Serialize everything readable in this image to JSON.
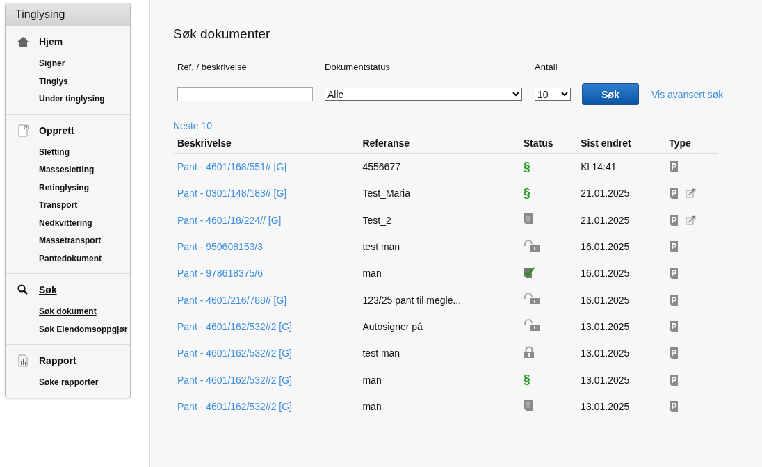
{
  "sidebar": {
    "title": "Tinglysing",
    "sections": [
      {
        "kind": "home",
        "label": "Hjem",
        "selected": false,
        "items": [
          {
            "label": "Signer",
            "selected": false
          },
          {
            "label": "Tinglys",
            "selected": false
          },
          {
            "label": "Under tinglysing",
            "selected": false
          }
        ]
      },
      {
        "kind": "create",
        "label": "Opprett",
        "selected": false,
        "items": [
          {
            "label": "Sletting",
            "selected": false
          },
          {
            "label": "Massesletting",
            "selected": false
          },
          {
            "label": "Retinglysing",
            "selected": false
          },
          {
            "label": "Transport",
            "selected": false
          },
          {
            "label": "Nedkvittering",
            "selected": false
          },
          {
            "label": "Massetransport",
            "selected": false
          },
          {
            "label": "Pantedokument",
            "selected": false
          }
        ]
      },
      {
        "kind": "search",
        "label": "Søk",
        "selected": true,
        "items": [
          {
            "label": "Søk dokument",
            "selected": true
          },
          {
            "label": "Søk Eiendomsoppgjør",
            "selected": false
          }
        ]
      },
      {
        "kind": "report",
        "label": "Rapport",
        "selected": false,
        "items": [
          {
            "label": "Søke rapporter",
            "selected": false
          }
        ]
      }
    ]
  },
  "main": {
    "title": "Søk dokumenter",
    "filters": {
      "ref_label": "Ref. / beskrivelse",
      "status_label": "Dokumentstatus",
      "status_value": "Alle",
      "count_label": "Antall",
      "count_value": "10",
      "search_button": "Søk",
      "advanced_link": "Vis avansert søk"
    },
    "next_link": "Neste 10",
    "table": {
      "columns": [
        "Beskrivelse",
        "Referanse",
        "Status",
        "Sist endret",
        "Type"
      ],
      "rows": [
        {
          "description": "Pant - 4601/168/551// [G]",
          "reference": "4556677",
          "kind": "paragraph",
          "status_symbol": "§",
          "changed": "Kl 14:41",
          "external": false
        },
        {
          "description": "Pant - 0301/148/183// [G]",
          "reference": "Test_Maria",
          "kind": "paragraph",
          "status_symbol": "§",
          "changed": "21.01.2025",
          "external": true
        },
        {
          "description": "Pant - 4601/18/224// [G]",
          "reference": "Test_2",
          "kind": "document",
          "changed": "21.01.2025",
          "external": true
        },
        {
          "description": "Pant - 950608153/3",
          "reference": "test man",
          "kind": "unlocked",
          "changed": "16.01.2025",
          "external": false
        },
        {
          "description": "Pant - 978618375/6",
          "reference": "man",
          "kind": "checked",
          "changed": "16.01.2025",
          "external": false
        },
        {
          "description": "Pant - 4601/216/788// [G]",
          "reference": "123/25 pant til megle...",
          "kind": "unlocked",
          "changed": "16.01.2025",
          "external": false
        },
        {
          "description": "Pant - 4601/162/532//2 [G]",
          "reference": "Autosigner på",
          "kind": "unlocked",
          "changed": "13.01.2025",
          "external": false
        },
        {
          "description": "Pant - 4601/162/532//2 [G]",
          "reference": "test man",
          "kind": "locked",
          "changed": "13.01.2025",
          "external": false
        },
        {
          "description": "Pant - 4601/162/532//2 [G]",
          "reference": "man",
          "kind": "paragraph",
          "status_symbol": "§",
          "changed": "13.01.2025",
          "external": false
        },
        {
          "description": "Pant - 4601/162/532//2 [G]",
          "reference": "man",
          "kind": "document",
          "changed": "13.01.2025",
          "external": false
        }
      ]
    }
  }
}
